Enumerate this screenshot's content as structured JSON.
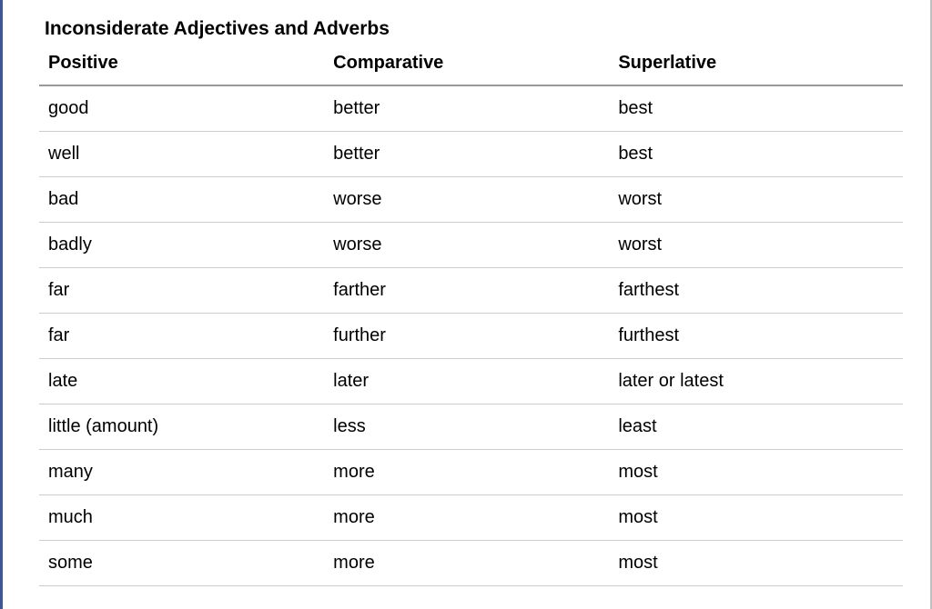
{
  "title": "Inconsiderate Adjectives and Adverbs",
  "headers": {
    "col1": "Positive",
    "col2": "Comparative",
    "col3": "Superlative"
  },
  "rows": [
    {
      "positive": "good",
      "comparative": "better",
      "superlative": "best"
    },
    {
      "positive": "well",
      "comparative": "better",
      "superlative": "best"
    },
    {
      "positive": "bad",
      "comparative": "worse",
      "superlative": "worst"
    },
    {
      "positive": "badly",
      "comparative": "worse",
      "superlative": "worst"
    },
    {
      "positive": "far",
      "comparative": "farther",
      "superlative": "farthest"
    },
    {
      "positive": "far",
      "comparative": "further",
      "superlative": "furthest"
    },
    {
      "positive": "late",
      "comparative": "later",
      "superlative": "later or latest"
    },
    {
      "positive": "little (amount)",
      "comparative": "less",
      "superlative": "least"
    },
    {
      "positive": "many",
      "comparative": "more",
      "superlative": "most"
    },
    {
      "positive": "much",
      "comparative": "more",
      "superlative": "most"
    },
    {
      "positive": "some",
      "comparative": "more",
      "superlative": "most"
    }
  ]
}
